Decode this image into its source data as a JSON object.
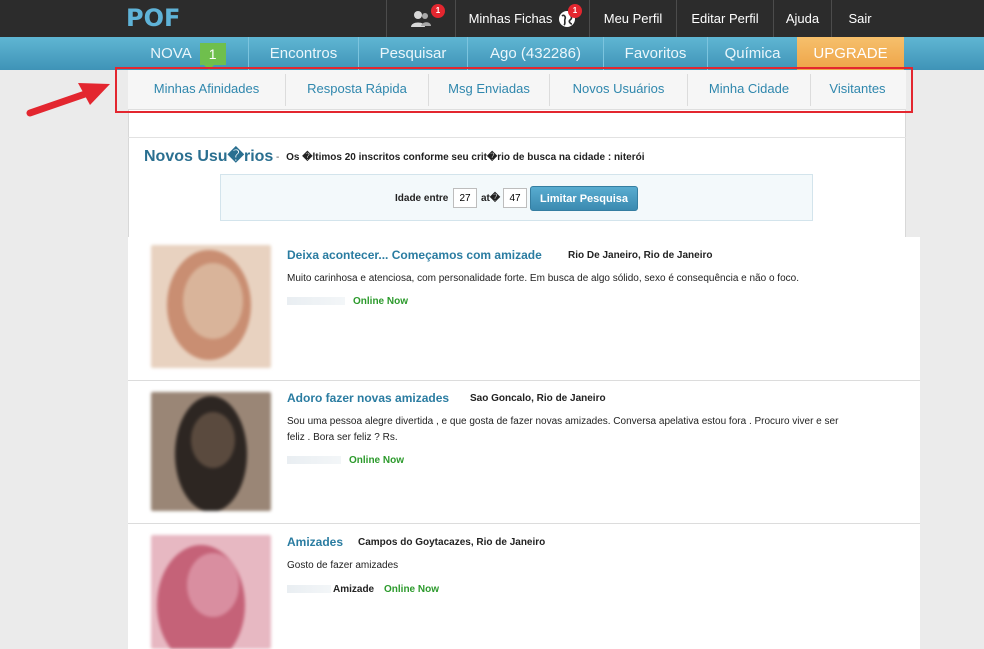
{
  "topbar": {
    "logo": "POF",
    "requests_badge": "1",
    "minhas_fichas": "Minhas Fichas",
    "fichas_badge": "1",
    "meu_perfil": "Meu Perfil",
    "editar_perfil": "Editar Perfil",
    "ajuda": "Ajuda",
    "sair": "Sair"
  },
  "mainnav": {
    "nova": "NOVA",
    "nova_count": "1",
    "encontros": "Encontros",
    "pesquisar": "Pesquisar",
    "ago": "Ago (432286)",
    "favoritos": "Favoritos",
    "quimica": "Química",
    "upgrade": "UPGRADE"
  },
  "subnav": {
    "minhas_afinidades": "Minhas Afinidades",
    "resposta_rapida": "Resposta Rápida",
    "msg_enviadas": "Msg Enviadas",
    "novos_usuarios": "Novos Usuários",
    "minha_cidade": "Minha Cidade",
    "visitantes": "Visitantes"
  },
  "section": {
    "title": "Novos Usu�rios",
    "dash": "-",
    "subtitle": "Os �ltimos 20 inscritos conforme seu crit�rio de busca na cidade : niterói"
  },
  "search": {
    "idade_label": "Idade entre",
    "min_age": "27",
    "ate_label": "at�",
    "max_age": "47",
    "button": "Limitar Pesquisa"
  },
  "listings": [
    {
      "title": "Deixa acontecer... Começamos com amizade",
      "location": "Rio De Janeiro, Rio de Janeiro",
      "description": "Muito carinhosa e atenciosa, com personalidade forte. Em busca de algo sólido, sexo é consequência e não o foco.",
      "status": "Online Now",
      "photo_colors": [
        "#d9b49a",
        "#c98e72",
        "#e8d2c0"
      ]
    },
    {
      "title": "Adoro fazer novas amizades",
      "location": "Sao Goncalo, Rio de Janeiro",
      "description": "Sou uma pessoa alegre divertida , e que gosta de fazer novas amizades. Conversa apelativa estou fora . Procuro viver e ser feliz . Bora ser feliz ? Rs.",
      "status": "Online Now",
      "photo_colors": [
        "#5a4a3e",
        "#9a8676",
        "#2d2622"
      ]
    },
    {
      "title": "Amizades",
      "location": "Campos do Goytacazes, Rio de Janeiro",
      "description": "Gosto de fazer amizades",
      "intent": "Amizade",
      "status": "Online Now",
      "photo_colors": [
        "#d98ea0",
        "#c56278",
        "#e7b8c2"
      ]
    }
  ],
  "colors": {
    "topbar": "#2c2c2c",
    "nav_blue": "#4fa6c8",
    "upgrade_orange": "#f0a84e",
    "highlight_red": "#e3262f",
    "link_blue": "#2a7ca1",
    "online_green": "#2c9a2c"
  }
}
